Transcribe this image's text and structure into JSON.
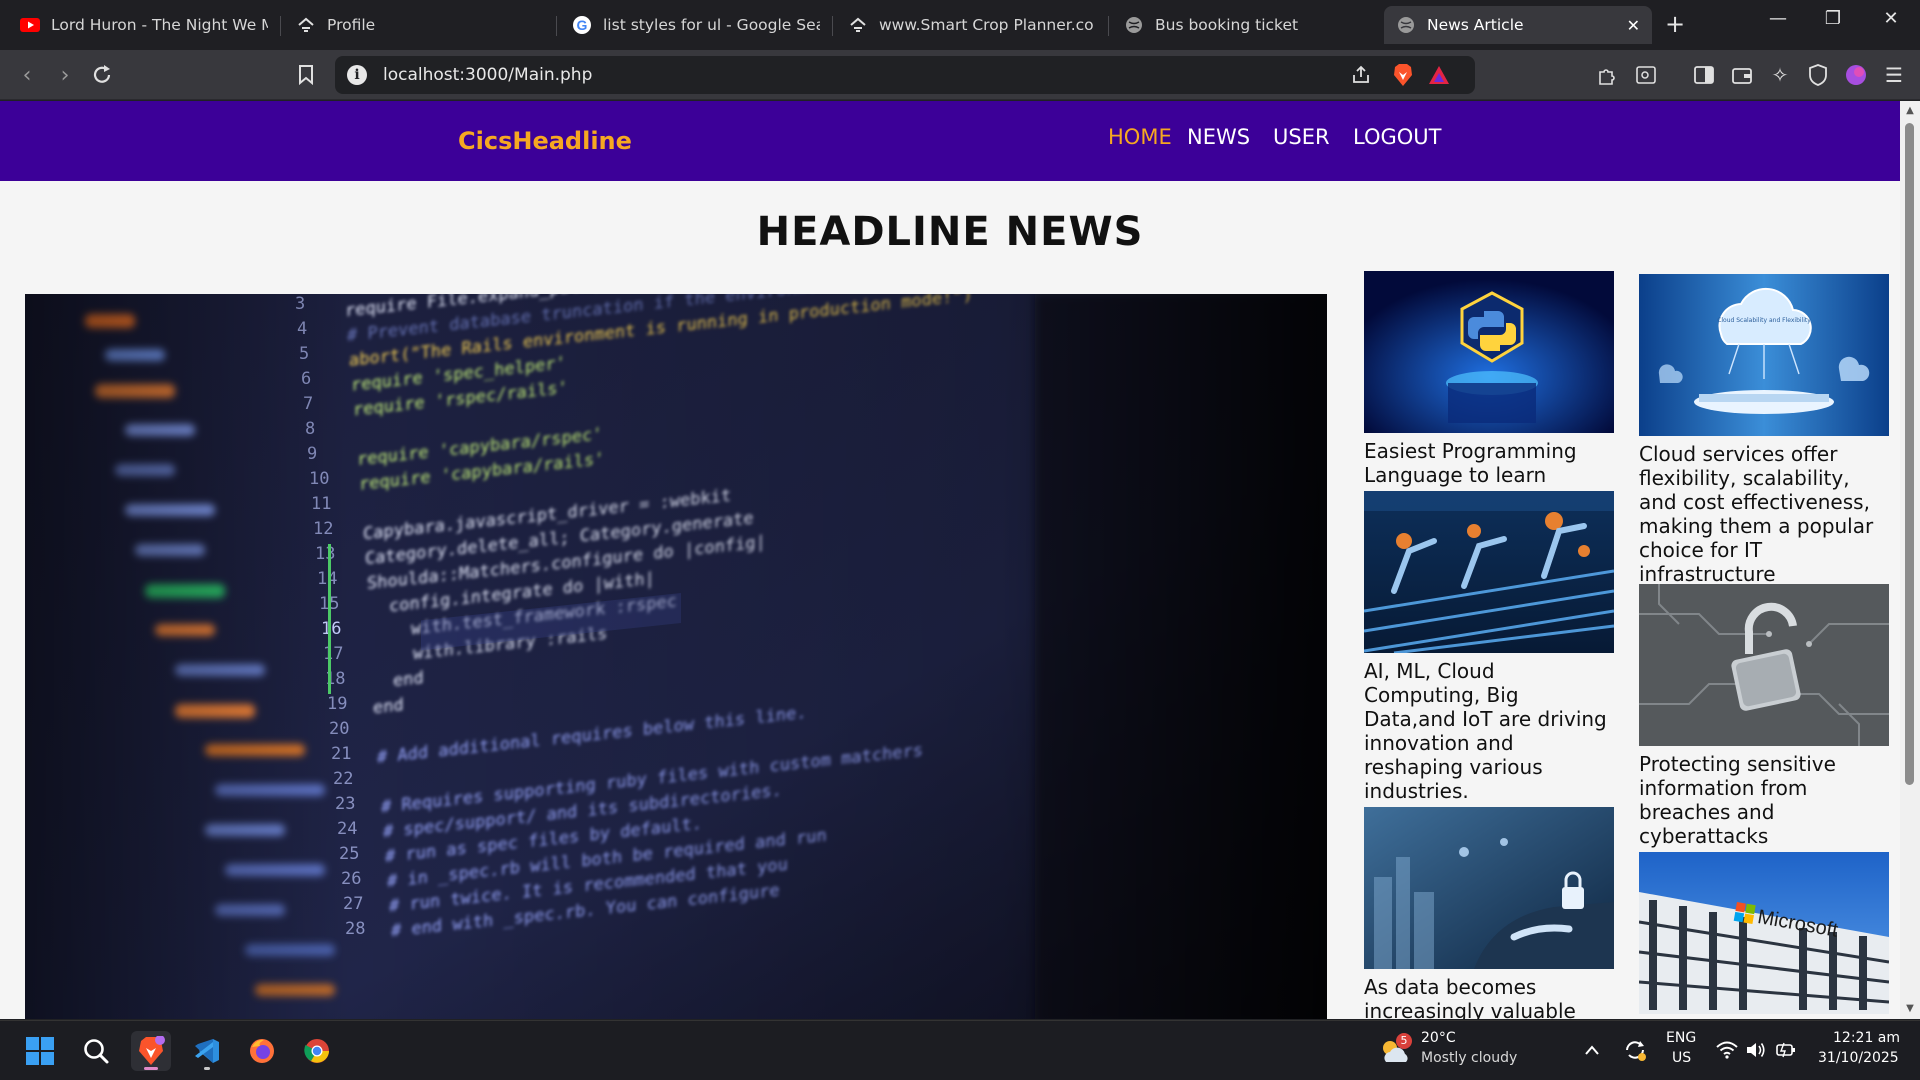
{
  "browser": {
    "tabs": [
      {
        "label": "Lord Huron - The Night We Met",
        "icon": "youtube-icon"
      },
      {
        "label": "Profile",
        "icon": "profile-icon"
      },
      {
        "label": "list styles for ul - Google Search",
        "icon": "google-icon"
      },
      {
        "label": "www.Smart Crop Planner.com",
        "icon": "crop-icon"
      },
      {
        "label": "Bus booking ticket",
        "icon": "globe-icon"
      },
      {
        "label": "News Article",
        "icon": "globe-icon",
        "active": true
      }
    ],
    "url": "localhost:3000/Main.php"
  },
  "site": {
    "logo": "CicsHeadline",
    "nav": [
      "HOME",
      "NEWS",
      "USER",
      "LOGOUT"
    ],
    "active_nav": "HOME",
    "heading": "HEADLINE NEWS",
    "colors": {
      "nav_bg": "#3c0098",
      "accent": "#f6a821",
      "page_bg": "#f5f5f5"
    }
  },
  "articles": [
    {
      "title": "Easiest Programming Language to learn",
      "image": "python-logo"
    },
    {
      "title": "Cloud services offer flexibility, scalability, and cost effectiveness, making them a popular choice for IT infrastructure",
      "image": "cloud",
      "image_caption": "Cloud Scalability and Flexibility"
    },
    {
      "title": "AI, ML, Cloud Computing, Big Data,and IoT are driving innovation and reshaping various industries.",
      "image": "robot-factory"
    },
    {
      "title": "Protecting sensitive information from breaches and cyberattacks",
      "image": "padlock-circuit"
    },
    {
      "title": "As data becomes increasingly valuable",
      "image": "cyber-lock"
    },
    {
      "title": "",
      "image": "microsoft-building",
      "image_caption": "Microsoft"
    }
  ],
  "taskbar": {
    "weather": {
      "temp": "20°C",
      "condition": "Mostly cloudy",
      "badge": "5"
    },
    "lang": [
      "ENG",
      "US"
    ],
    "time": "12:21 am",
    "date": "31/10/2025"
  }
}
